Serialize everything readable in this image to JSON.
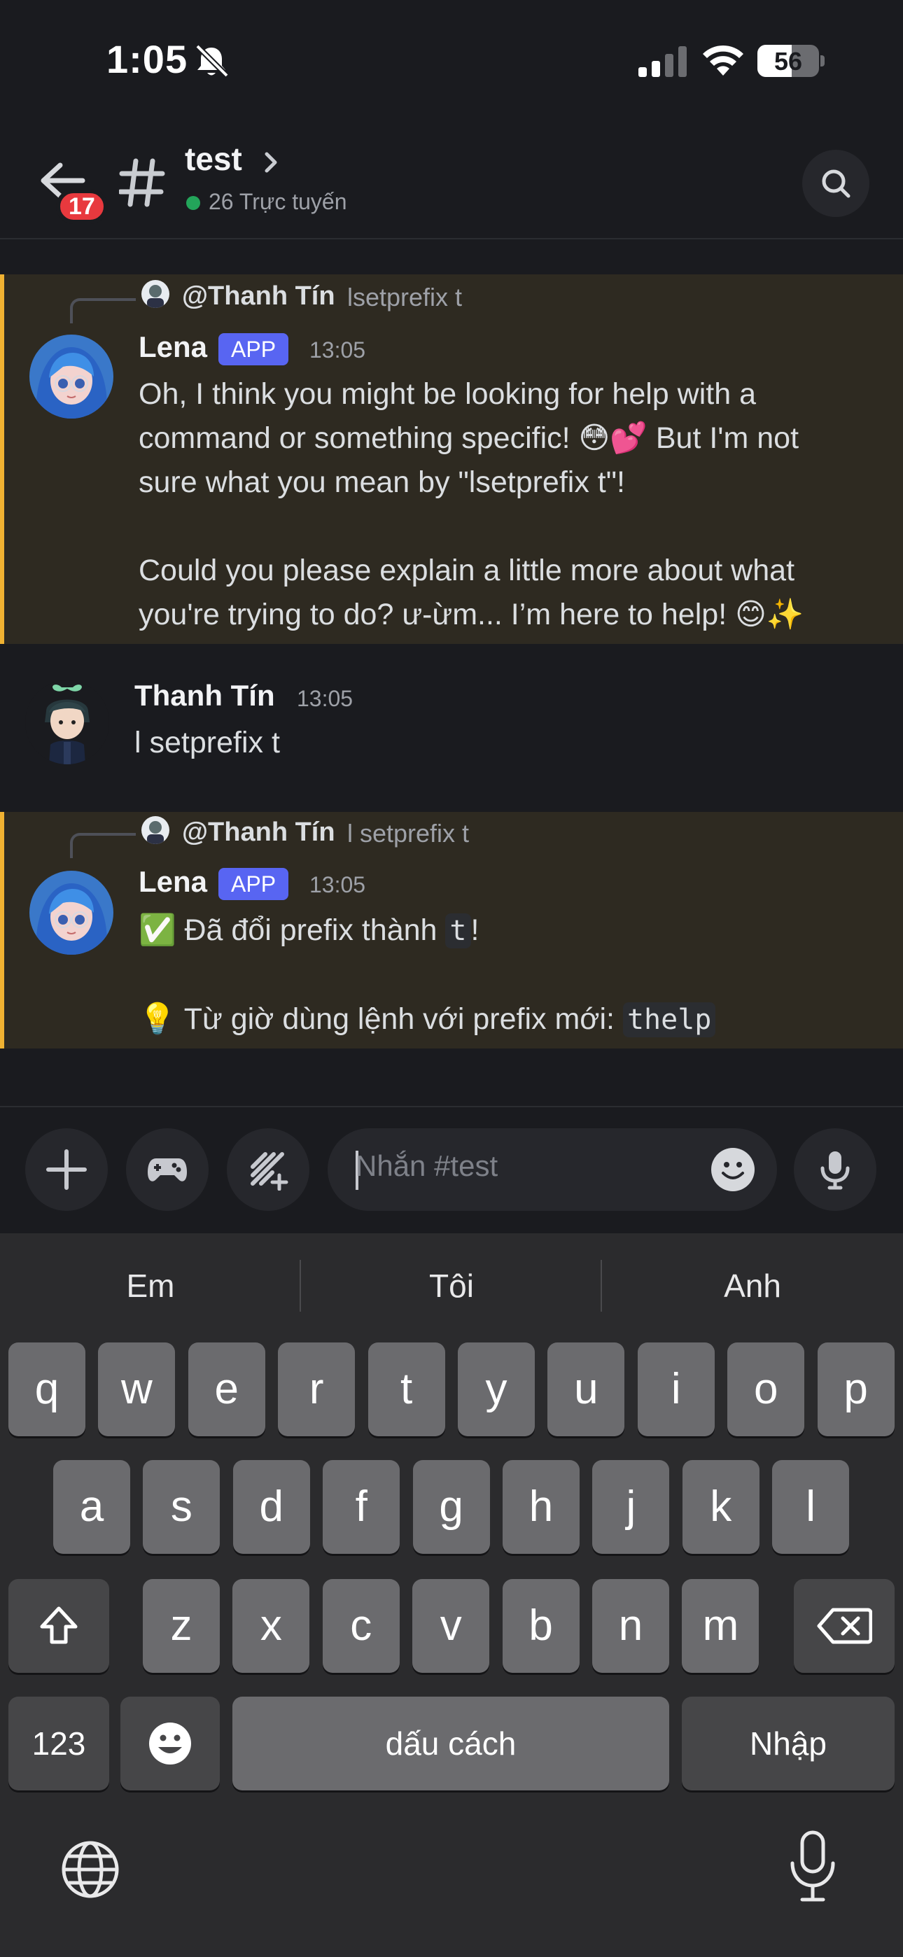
{
  "status_bar": {
    "time": "1:05",
    "battery": "56",
    "battery_level": 0.56
  },
  "header": {
    "unread_badge": "17",
    "channel_name": "test",
    "online_text": "26 Trực tuyến"
  },
  "messages": [
    {
      "reply_author": "@Thanh Tín",
      "reply_text": "lsetprefix t",
      "author": "Lena",
      "tag": "APP",
      "time": "13:05",
      "lines": [
        "Oh, I think you might be looking for help with a",
        "command or something specific! 😳💕 But I'm not",
        "sure what you mean by \"lsetprefix t\"!",
        "",
        "Could you please explain a little more about what",
        "you're trying to do? ư-ừm... I’m here to help! 😊✨"
      ]
    },
    {
      "author": "Thanh Tín",
      "time": "13:05",
      "text": "l setprefix t"
    },
    {
      "reply_author": "@Thanh Tín",
      "reply_text": "l setprefix t",
      "author": "Lena",
      "tag": "APP",
      "time": "13:05",
      "line1_emoji": "✅",
      "line1_text": "Đã đổi prefix thành",
      "line1_code": "t",
      "line1_end": "!",
      "line2_emoji": "💡",
      "line2_text": "Từ giờ dùng lệnh với prefix mới:",
      "line2_code": "thelp"
    }
  ],
  "composer": {
    "placeholder": "Nhắn #test"
  },
  "keyboard": {
    "suggestions": [
      "Em",
      "Tôi",
      "Anh"
    ],
    "row1": [
      "q",
      "w",
      "e",
      "r",
      "t",
      "y",
      "u",
      "i",
      "o",
      "p"
    ],
    "row2": [
      "a",
      "s",
      "d",
      "f",
      "g",
      "h",
      "j",
      "k",
      "l"
    ],
    "row3": [
      "z",
      "x",
      "c",
      "v",
      "b",
      "n",
      "m"
    ],
    "numbers_key": "123",
    "space_key": "dấu cách",
    "return_key": "Nhập"
  },
  "icons": {
    "back": "arrow-left-icon",
    "channel": "hash-icon",
    "search": "search-icon",
    "add": "plus-icon",
    "games": "gamepad-icon",
    "apps": "apps-icon",
    "emoji": "emoji-icon",
    "voice": "microphone-icon",
    "shift": "shift-icon",
    "delete": "backspace-icon",
    "globe": "globe-icon",
    "dictation": "dictation-icon"
  },
  "colors": {
    "mention_bar": "#f0b232",
    "app_tag": "#5865f2",
    "badge": "#e8393e",
    "online": "#23a55a"
  }
}
